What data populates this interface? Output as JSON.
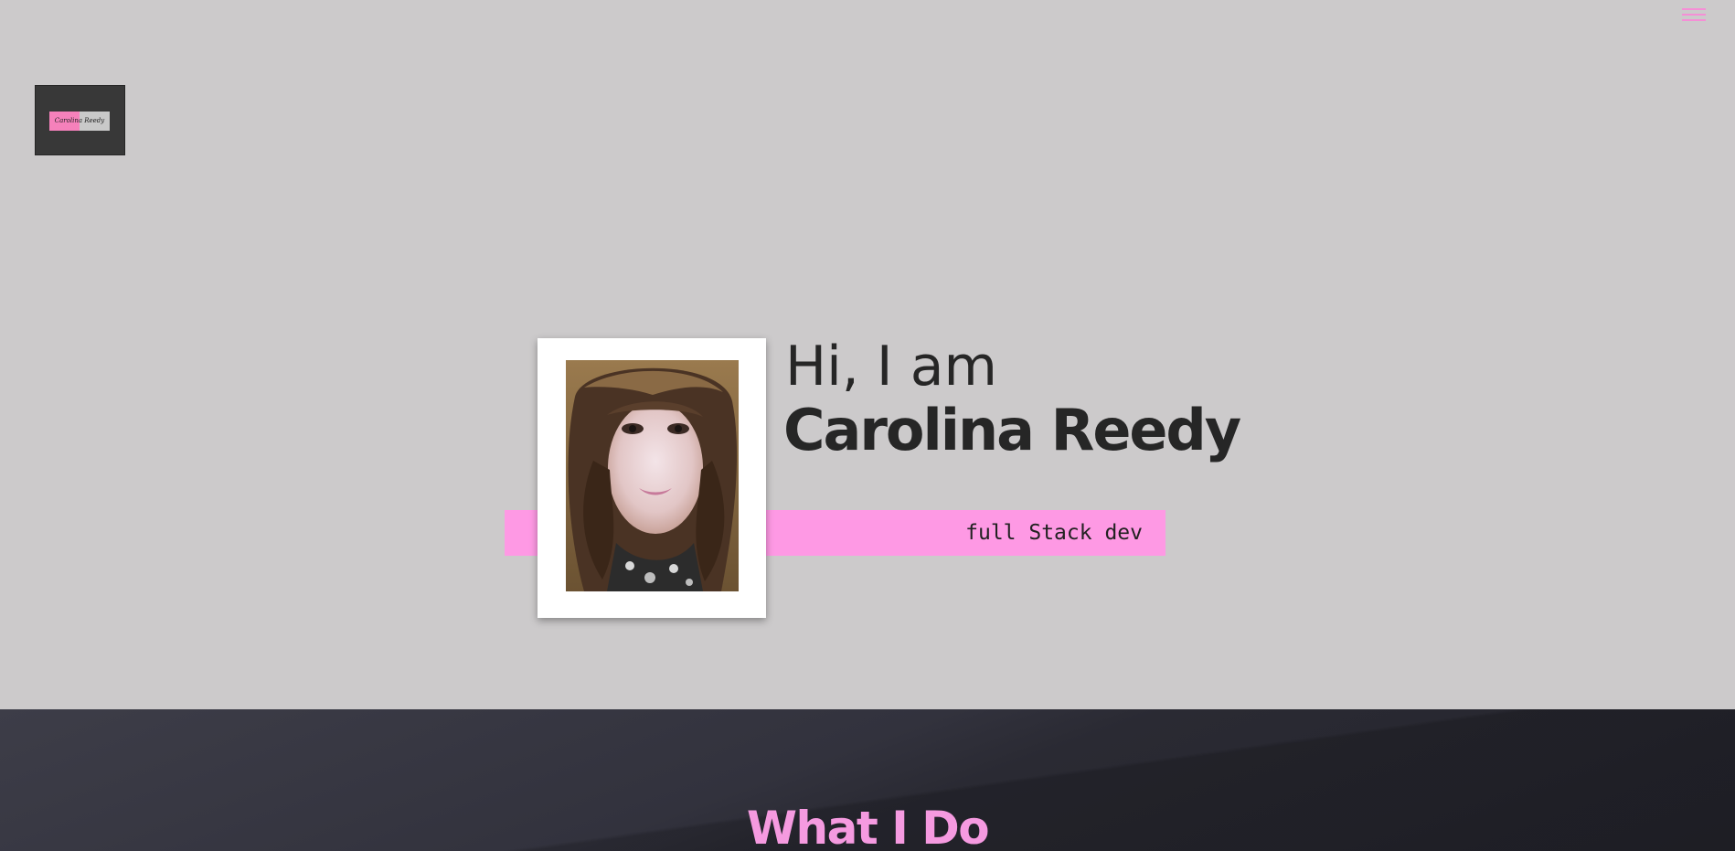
{
  "header": {
    "menu_icon": "hamburger-menu-icon",
    "logo_text": "Carolina Reedy"
  },
  "hero": {
    "greeting": "Hi, I am",
    "name": "Carolina Reedy",
    "role": "full Stack dev",
    "accent_color": "#fe99e4"
  },
  "services": {
    "title": "What I Do",
    "title_color": "#f59ae0"
  }
}
